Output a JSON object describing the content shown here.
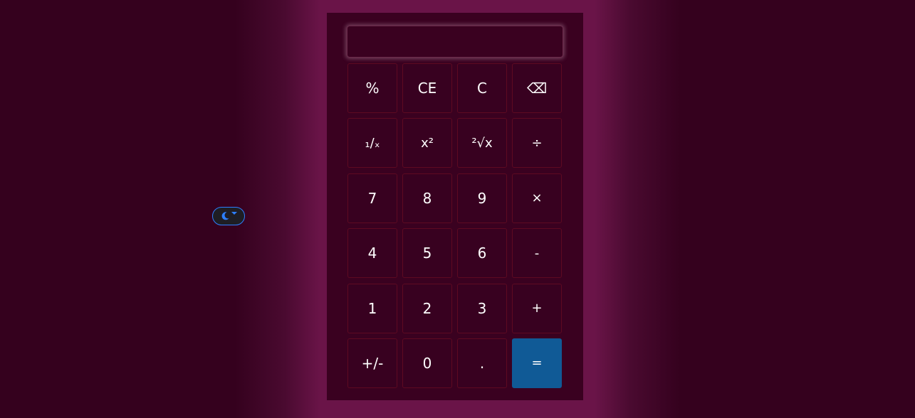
{
  "display": {
    "value": ""
  },
  "theme_toggle": {
    "icon": "moon-icon",
    "caret_icon": "caret-down-icon",
    "accent_color": "#2d7fff"
  },
  "keypad": {
    "rows": [
      [
        "%",
        "CE",
        "C",
        "⌫"
      ],
      [
        "₁/ₓ",
        "x²",
        "²√x",
        "÷"
      ],
      [
        "7",
        "8",
        "9",
        "×"
      ],
      [
        "4",
        "5",
        "6",
        "-"
      ],
      [
        "1",
        "2",
        "3",
        "+"
      ],
      [
        "+/-",
        "0",
        ".",
        "="
      ]
    ],
    "equals_color": "#105a96"
  }
}
